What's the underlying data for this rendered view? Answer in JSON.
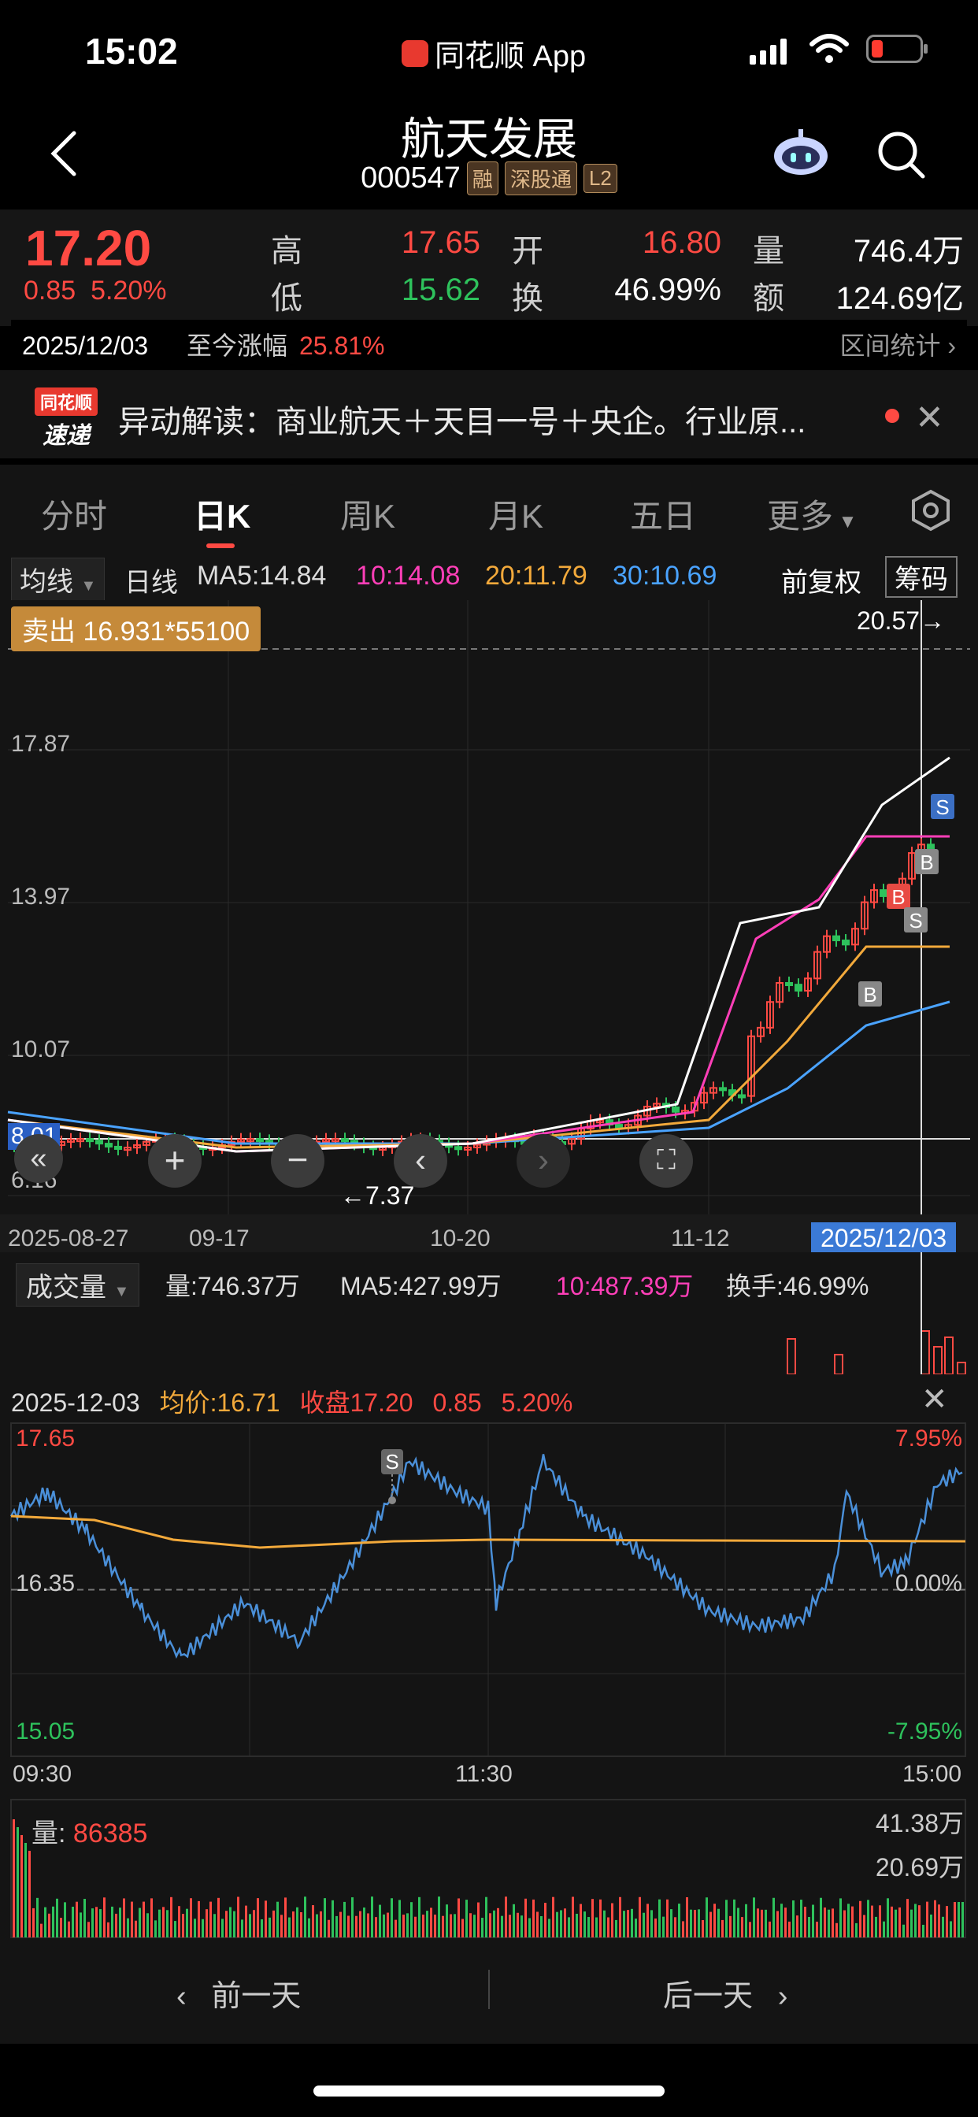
{
  "status_bar": {
    "time": "15:02",
    "app": "同花顺 App"
  },
  "stock": {
    "name": "航天发展",
    "code": "000547",
    "tags": [
      "融",
      "深股通",
      "L2"
    ]
  },
  "quote": {
    "price": "17.20",
    "change": "0.85",
    "change_pct": "5.20%",
    "high_label": "高",
    "high": "17.65",
    "low_label": "低",
    "low": "15.62",
    "open_label": "开",
    "open": "16.80",
    "turnover_label": "换",
    "turnover": "46.99%",
    "volume_label": "量",
    "volume": "746.4万",
    "amount_label": "额",
    "amount": "124.69亿"
  },
  "period": {
    "date": "2025/12/03",
    "label": "至今涨幅",
    "value": "25.81%",
    "stats": "区间统计"
  },
  "news": {
    "logo_top": "同花顺",
    "logo_bottom": "速递",
    "text": "异动解读：商业航天＋天目一号＋央企。行业原..."
  },
  "tabs": [
    {
      "label": "分时"
    },
    {
      "label": "日K"
    },
    {
      "label": "周K"
    },
    {
      "label": "月K"
    },
    {
      "label": "五日"
    },
    {
      "label": "更多"
    }
  ],
  "ma_row": {
    "selector": "均线",
    "line": "日线",
    "ma5": "MA5:14.84",
    "ma10": "10:14.08",
    "ma20": "20:11.79",
    "ma30": "30:10.69",
    "adjust": "前复权",
    "chips": "筹码"
  },
  "kchart": {
    "trade_tag": "卖出 16.931*55100",
    "high_mark": "20.57→",
    "low_mark": "←7.37",
    "y_labels": [
      "17.87",
      "13.97",
      "10.07",
      "6.16"
    ],
    "current_level": "8.01",
    "x_labels": [
      "2025-08-27",
      "09-17",
      "10-20",
      "11-12"
    ],
    "cursor_date": "2025/12/03",
    "markers": [
      "S",
      "B",
      "B",
      "S",
      "B"
    ],
    "colors": {
      "up": "#ff4a43",
      "down": "#2ec25c",
      "ma5": "#ffffff",
      "ma10": "#ff3fb8",
      "ma20": "#f2a93b",
      "ma30": "#4aa3ff"
    }
  },
  "volume_row": {
    "selector": "成交量",
    "vol": "量:746.37万",
    "ma5": "MA5:427.99万",
    "ma10": "10:487.39万",
    "turnover": "换手:46.99%"
  },
  "intraday": {
    "date": "2025-12-03",
    "avg_label": "均价:",
    "avg": "16.71",
    "close_label": "收盘",
    "close": "17.20",
    "change": "0.85",
    "change_pct": "5.20%",
    "y_top": "17.65",
    "y_mid": "16.35",
    "y_bottom": "15.05",
    "pct_top": "7.95%",
    "pct_mid": "0.00%",
    "pct_bottom": "-7.95%",
    "times": [
      "09:30",
      "11:30",
      "15:00"
    ],
    "marker": "S",
    "vol_label": "量:",
    "vol_value": "86385",
    "vol_max": "41.38万",
    "vol_mid": "20.69万"
  },
  "bottom_nav": {
    "prev": "前一天",
    "next": "后一天"
  }
}
